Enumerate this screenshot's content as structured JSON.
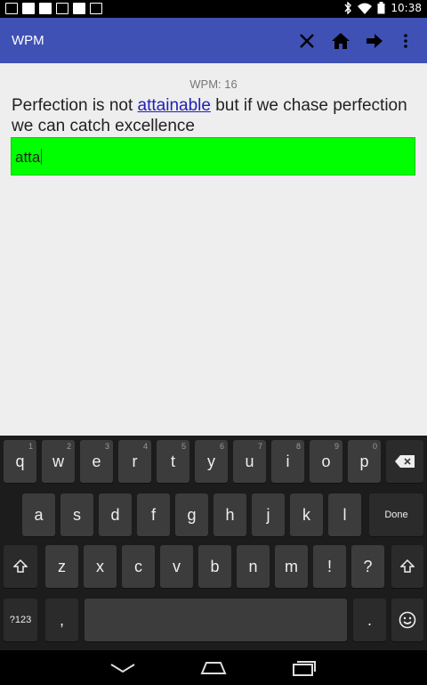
{
  "status_bar": {
    "time": "10:38"
  },
  "app_bar": {
    "title": "WPM"
  },
  "content": {
    "wpm_label": "WPM: 16",
    "sentence_before": "Perfection is not ",
    "sentence_highlight": "attainable",
    "sentence_after": " but if we chase perfection we can catch excellence",
    "input_value": "atta",
    "input_color": "#00ff00"
  },
  "keyboard": {
    "row1": [
      {
        "label": "q",
        "hint": "1"
      },
      {
        "label": "w",
        "hint": "2"
      },
      {
        "label": "e",
        "hint": "3"
      },
      {
        "label": "r",
        "hint": "4"
      },
      {
        "label": "t",
        "hint": "5"
      },
      {
        "label": "y",
        "hint": "6"
      },
      {
        "label": "u",
        "hint": "7"
      },
      {
        "label": "i",
        "hint": "8"
      },
      {
        "label": "o",
        "hint": "9"
      },
      {
        "label": "p",
        "hint": "0"
      }
    ],
    "row2": [
      {
        "label": "a"
      },
      {
        "label": "s"
      },
      {
        "label": "d"
      },
      {
        "label": "f"
      },
      {
        "label": "g"
      },
      {
        "label": "h"
      },
      {
        "label": "j"
      },
      {
        "label": "k"
      },
      {
        "label": "l"
      }
    ],
    "done_label": "Done",
    "row3": [
      {
        "label": "z"
      },
      {
        "label": "x"
      },
      {
        "label": "c"
      },
      {
        "label": "v"
      },
      {
        "label": "b"
      },
      {
        "label": "n"
      },
      {
        "label": "m"
      },
      {
        "label": "!"
      },
      {
        "label": "?"
      }
    ],
    "symbols_label": "?123",
    "comma_label": ",",
    "period_label": "."
  }
}
